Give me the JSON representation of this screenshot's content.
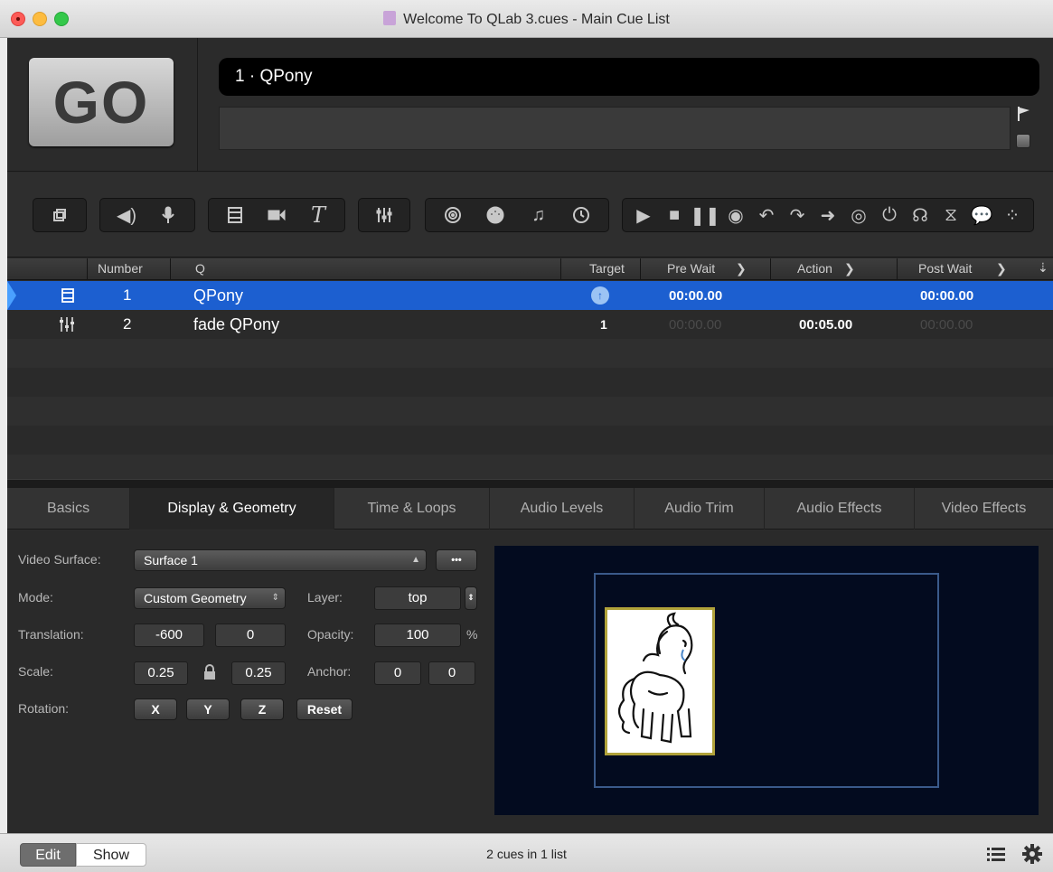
{
  "window": {
    "title": "Welcome To QLab 3.cues - Main Cue List"
  },
  "go": {
    "label": "GO"
  },
  "standby": {
    "cue": "1 · QPony",
    "notes": ""
  },
  "cue_table": {
    "columns": [
      "Number",
      "Q",
      "Target",
      "Pre Wait",
      "Action",
      "Post Wait"
    ],
    "rows": [
      {
        "type_icon": "video-cue-icon",
        "number": "1",
        "name": "QPony",
        "target": "",
        "pre_wait": "00:00.00",
        "action": "",
        "post_wait": "00:00.00",
        "selected": true
      },
      {
        "type_icon": "fade-cue-icon",
        "number": "2",
        "name": "fade QPony",
        "target": "1",
        "pre_wait": "00:00.00",
        "action": "00:05.00",
        "post_wait": "00:00.00",
        "selected": false
      }
    ]
  },
  "tabs": [
    "Basics",
    "Display & Geometry",
    "Time & Loops",
    "Audio Levels",
    "Audio Trim",
    "Audio Effects",
    "Video Effects"
  ],
  "active_tab": "Display & Geometry",
  "inspector": {
    "video_surface_label": "Video Surface:",
    "video_surface_value": "Surface 1",
    "more_button": "•••",
    "mode_label": "Mode:",
    "mode_value": "Custom Geometry",
    "layer_label": "Layer:",
    "layer_value": "top",
    "translation_label": "Translation:",
    "translation_x": "-600",
    "translation_y": "0",
    "opacity_label": "Opacity:",
    "opacity_value": "100",
    "opacity_unit": "%",
    "scale_label": "Scale:",
    "scale_x": "0.25",
    "scale_y": "0.25",
    "anchor_label": "Anchor:",
    "anchor_x": "0",
    "anchor_y": "0",
    "rotation_label": "Rotation:",
    "rot_x": "X",
    "rot_y": "Y",
    "rot_z": "Z",
    "reset": "Reset"
  },
  "statusbar": {
    "edit": "Edit",
    "show": "Show",
    "text": "2 cues in 1 list"
  }
}
